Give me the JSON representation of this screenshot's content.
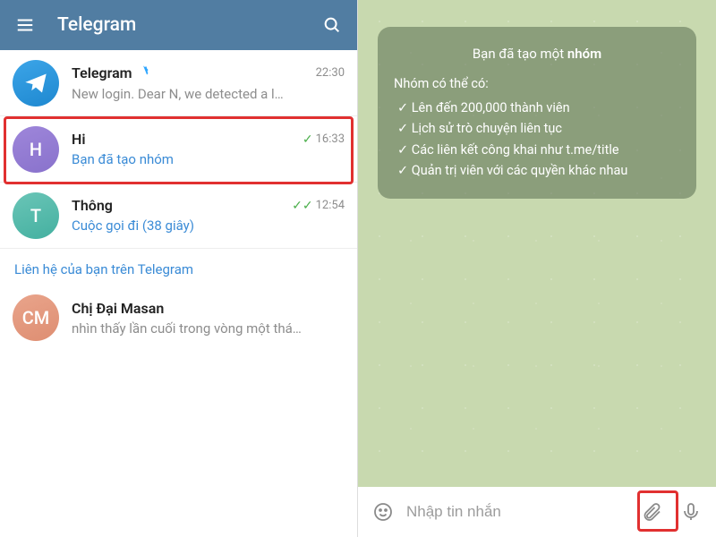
{
  "left": {
    "appTitle": "Telegram",
    "chats": [
      {
        "name": "Telegram",
        "verified": true,
        "time": "22:30",
        "preview": "New login. Dear N, we detected a l…",
        "previewGrey": true,
        "avatarLetter": "",
        "ticks": 0
      },
      {
        "name": "Hi",
        "verified": false,
        "time": "16:33",
        "preview": "Bạn đã tạo nhóm",
        "previewGrey": false,
        "avatarLetter": "H",
        "ticks": 1
      },
      {
        "name": "Thông",
        "verified": false,
        "time": "12:54",
        "preview": "Cuộc gọi đi (38 giây)",
        "previewGrey": false,
        "avatarLetter": "T",
        "ticks": 2
      }
    ],
    "contactsHeader": "Liên hệ của bạn trên Telegram",
    "contact": {
      "initials": "CM",
      "name": "Chị Đại Masan",
      "status": "nhìn thấy lần cuối trong vòng một thá…"
    }
  },
  "right": {
    "info": {
      "titlePrefix": "Bạn đã tạo một ",
      "titleBold": "nhóm",
      "subtitle": "Nhóm có thể có:",
      "items": [
        "Lên đến 200,000 thành viên",
        "Lịch sử trò chuyện liên tục",
        "Các liên kết công khai như t.me/title",
        "Quản trị viên với các quyền khác nhau"
      ]
    },
    "inputPlaceholder": "Nhập tin nhắn"
  }
}
